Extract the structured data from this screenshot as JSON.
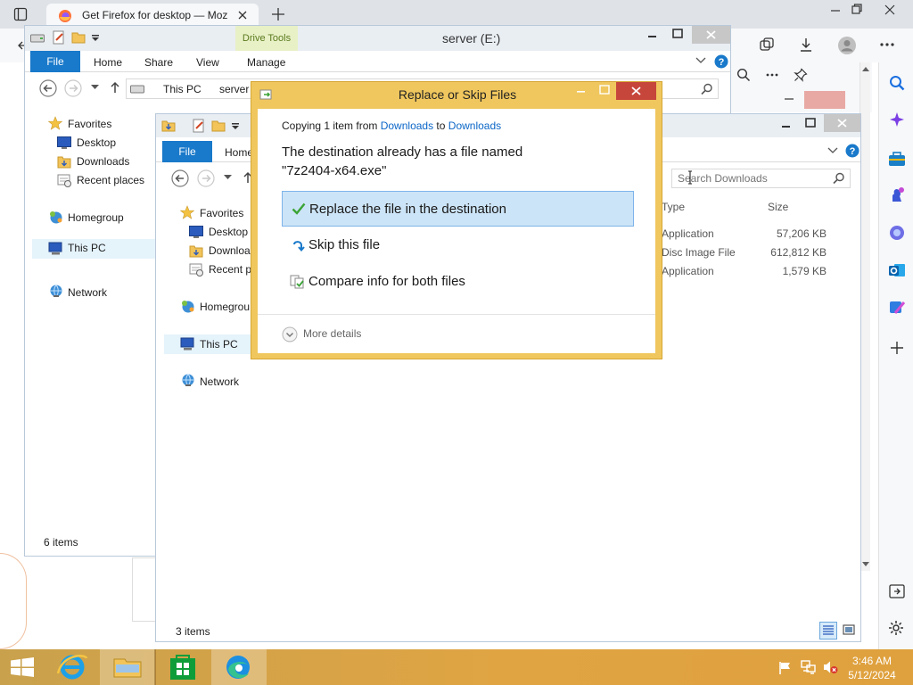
{
  "browser": {
    "tab_title": "Get Firefox for desktop — Moz"
  },
  "explorer_back": {
    "title": "server (E:)",
    "context_tab": "Drive Tools",
    "ribbon_tabs": [
      "File",
      "Home",
      "Share",
      "View",
      "Manage"
    ],
    "breadcrumb": [
      "This PC",
      "server ("
    ],
    "nav": {
      "favorites": "Favorites",
      "desktop": "Desktop",
      "downloads": "Downloads",
      "recent": "Recent places",
      "homegroup": "Homegroup",
      "this_pc": "This PC",
      "network": "Network"
    },
    "status": "6 items"
  },
  "explorer_front": {
    "ribbon_tabs": [
      "File",
      "Home"
    ],
    "search_placeholder": "Search Downloads",
    "columns": {
      "type": "Type",
      "size": "Size"
    },
    "rows": [
      {
        "type": "Application",
        "size": "57,206 KB"
      },
      {
        "type": "Disc Image File",
        "size": "612,812 KB"
      },
      {
        "type": "Application",
        "size": "1,579 KB"
      }
    ],
    "nav": {
      "favorites": "Favorites",
      "desktop": "Desktop",
      "downloads": "Downloa",
      "recent": "Recent pl",
      "homegroup": "Homegrou",
      "this_pc": "This PC",
      "network": "Network"
    },
    "status": "3 items"
  },
  "dialog": {
    "title": "Replace or Skip Files",
    "copying_prefix": "Copying 1 item from ",
    "source": "Downloads",
    "to_word": " to ",
    "destination": "Downloads",
    "message_line1": "The destination already has a file named",
    "message_line2": "\"7z2404-x64.exe\"",
    "options": {
      "replace": "Replace the file in the destination",
      "skip": "Skip this file",
      "compare": "Compare info for both files"
    },
    "more_details": "More details"
  },
  "taskbar": {
    "time": "3:46 AM",
    "date": "5/12/2024"
  },
  "colors": {
    "accent": "#1979ca",
    "dialog_frame": "#f0c75e",
    "close_red": "#c7463c",
    "check_green": "#3aa335"
  }
}
